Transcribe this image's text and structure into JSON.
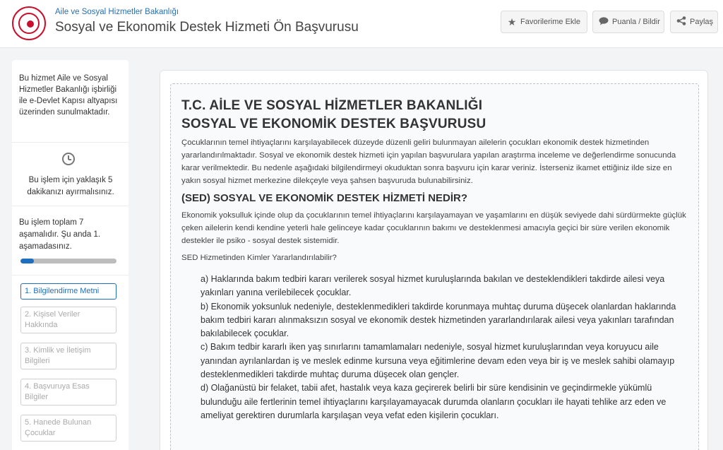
{
  "header": {
    "ministry": "Aile ve Sosyal Hizmetler Bakanlığı",
    "title": "Sosyal ve Ekonomik Destek Hizmeti Ön Başvurusu",
    "buttons": {
      "favorites": "Favorilerime Ekle",
      "rate": "Puanla / Bildir",
      "share": "Paylaş"
    },
    "icons": {
      "favorites": "star-icon",
      "rate": "speech-bubble-icon",
      "share": "share-icon"
    }
  },
  "sidebar": {
    "note": "Bu hizmet Aile ve Sosyal Hizmetler Bakanlığı işbirliği ile e-Devlet Kapısı altyapısı üzerinden sunulmaktadır.",
    "time": "Bu işlem için yaklaşık 5 dakikanızı ayırmalısınız.",
    "stage": "Bu işlem toplam 7 aşamalıdır. Şu anda 1. aşamadasınız.",
    "progress": 0.14,
    "steps": [
      "1. Bilgilendirme Metni",
      "2. Kişisel Veriler Hakkında",
      "3. Kimlik ve İletişim Bilgileri",
      "4. Başvuruya Esas Bilgiler",
      "5. Hanede Bulunan Çocuklar"
    ]
  },
  "content": {
    "heading1": "T.C. AİLE VE SOSYAL HİZMETLER BAKANLIĞI",
    "heading2": "SOSYAL VE EKONOMİK DESTEK BAŞVURUSU",
    "intro": "Çocuklarının temel ihtiyaçlarını karşılayabilecek düzeyde düzenli geliri bulunmayan ailelerin çocukları ekonomik destek hizmetinden yararlandırılmaktadır. Sosyal ve ekonomik destek hizmeti için yapılan başvurulara yapılan araştırma inceleme ve değerlendirme sonucunda karar verilmektedir. Bu nedenle aşağıdaki bilgilendirmeyi okuduktan sonra başvuru için karar veriniz. İsterseniz ikamet ettiğiniz ilde size en yakın sosyal hizmet merkezine dilekçeyle veya şahsen başvuruda bulunabilirsiniz.",
    "section_title": "(SED) SOSYAL VE EKONOMİK DESTEK HİZMETİ NEDİR?",
    "definition": "Ekonomik yoksulluk içinde olup da çocuklarının temel ihtiyaçlarını karşılayamayan ve yaşamlarını en düşük seviyede dahi sürdürmekte güçlük çeken ailelerin kendi kendine yeterli hale gelinceye kadar çocuklarının bakımı ve desteklenmesi amacıyla geçici bir süre verilen ekonomik destekler ile psiko - sosyal destek sistemidir.",
    "question": "SED Hizmetinden Kimler Yararlandırılabilir?",
    "items": [
      "a) Haklarında bakım tedbiri kararı verilerek sosyal hizmet kuruluşlarında bakılan ve desteklendikleri takdirde ailesi veya yakınları yanına verilebilecek çocuklar.",
      "b) Ekonomik yoksunluk nedeniyle, desteklenmedikleri takdirde korunmaya muhtaç duruma düşecek olanlardan haklarında bakım tedbiri kararı alınmaksızın sosyal ve ekonomik destek hizmetinden yararlandırılarak ailesi veya yakınları tarafından bakılabilecek çocuklar.",
      "c) Bakım tedbir kararlı iken yaş sınırlarını tamamlamaları nedeniyle, sosyal hizmet kuruluşlarından veya koruyucu aile yanından ayrılanlardan iş ve meslek edinme kursuna veya eğitimlerine devam eden veya bir iş ve meslek sahibi olamayıp desteklenmedikleri takdirde muhtaç duruma düşecek olan gençler.",
      "d) Olağanüstü bir felaket, tabii afet, hastalık veya kaza geçirerek belirli bir süre kendisinin ve geçindirmekle yükümlü bulunduğu aile fertlerinin temel ihtiyaçlarını karşılayamayacak durumda olanların çocukları ile hayati tehlike arz eden ve ameliyat gerektiren durumlarla karşılaşan veya vefat eden kişilerin çocukları."
    ]
  }
}
